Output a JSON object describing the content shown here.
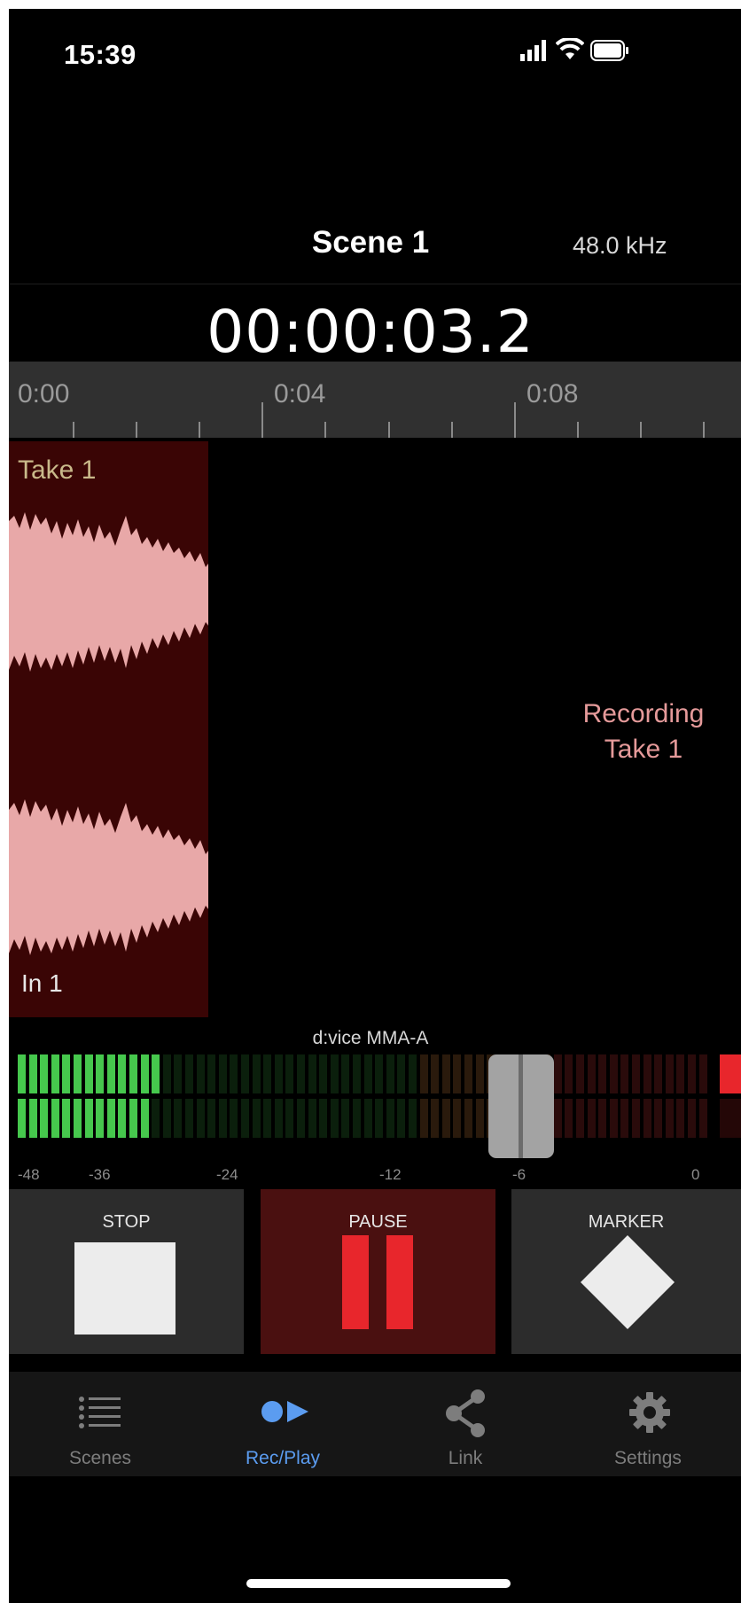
{
  "status_bar": {
    "time": "15:39"
  },
  "header": {
    "scene_title": "Scene 1",
    "sample_rate": "48.0 kHz"
  },
  "counter": "00:00:03.2",
  "timeline": {
    "labels": [
      "0:00",
      "0:04",
      "0:08"
    ]
  },
  "track": {
    "take_name": "Take 1",
    "input_name": "In 1",
    "status_line1": "Recording",
    "status_line2": "Take 1"
  },
  "meter": {
    "device_name": "d:vice MMA-A",
    "scale_labels": [
      "-48",
      "-36",
      "-24",
      "-12",
      "-6",
      "0"
    ],
    "fader_level_db": -6,
    "channel_levels_segments": [
      13,
      12
    ],
    "clip_indicator": "on"
  },
  "transport": {
    "stop_label": "STOP",
    "pause_label": "PAUSE",
    "marker_label": "MARKER",
    "pause_active_color": "#4a1010",
    "accent_red": "#e8262c"
  },
  "tabs": [
    {
      "label": "Scenes",
      "icon": "list-icon",
      "active": false
    },
    {
      "label": "Rec/Play",
      "icon": "record-play-icon",
      "active": true
    },
    {
      "label": "Link",
      "icon": "share-icon",
      "active": false
    },
    {
      "label": "Settings",
      "icon": "gear-icon",
      "active": false
    }
  ],
  "colors": {
    "active_tab": "#5b9cf0",
    "inactive_tab": "#7d7d7d",
    "meter_green": "#46c84d",
    "take_bg": "#3a0505",
    "waveform": "#e8a8a8"
  }
}
